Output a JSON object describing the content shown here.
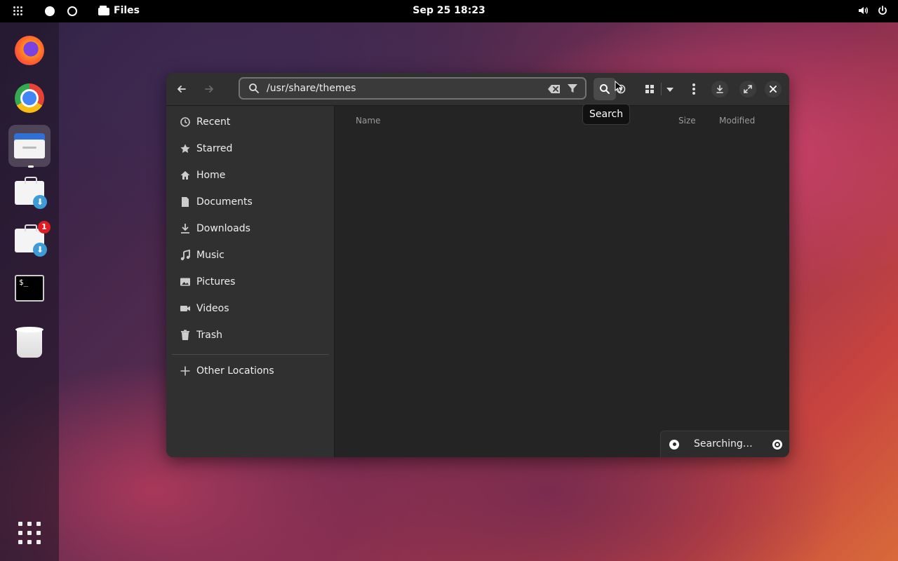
{
  "topbar": {
    "app_name": "Files",
    "clock": "Sep 25  18:23"
  },
  "dock": {
    "items": [
      {
        "name": "Firefox",
        "icon": "firefox-icon"
      },
      {
        "name": "Google Chrome",
        "icon": "chrome-icon"
      },
      {
        "name": "Files",
        "icon": "files-icon",
        "active": true
      },
      {
        "name": "Software Updater",
        "icon": "bag-download-icon"
      },
      {
        "name": "App Installer",
        "icon": "bag-download-icon",
        "badge": "1"
      },
      {
        "name": "Terminal",
        "icon": "terminal-icon",
        "text": "$_"
      },
      {
        "name": "Trash",
        "icon": "trash-icon"
      }
    ]
  },
  "window": {
    "path": "/usr/share/themes",
    "tooltip": "Search",
    "sidebar": {
      "items": [
        {
          "label": "Recent",
          "icon": "clock-icon"
        },
        {
          "label": "Starred",
          "icon": "star-icon"
        },
        {
          "label": "Home",
          "icon": "home-icon"
        },
        {
          "label": "Documents",
          "icon": "document-icon"
        },
        {
          "label": "Downloads",
          "icon": "download-icon"
        },
        {
          "label": "Music",
          "icon": "music-icon"
        },
        {
          "label": "Pictures",
          "icon": "picture-icon"
        },
        {
          "label": "Videos",
          "icon": "video-icon"
        },
        {
          "label": "Trash",
          "icon": "trash-icon"
        }
      ],
      "other_locations": "Other Locations"
    },
    "columns": {
      "name": "Name",
      "size": "Size",
      "modified": "Modified"
    },
    "status": {
      "text": "Searching…"
    }
  }
}
